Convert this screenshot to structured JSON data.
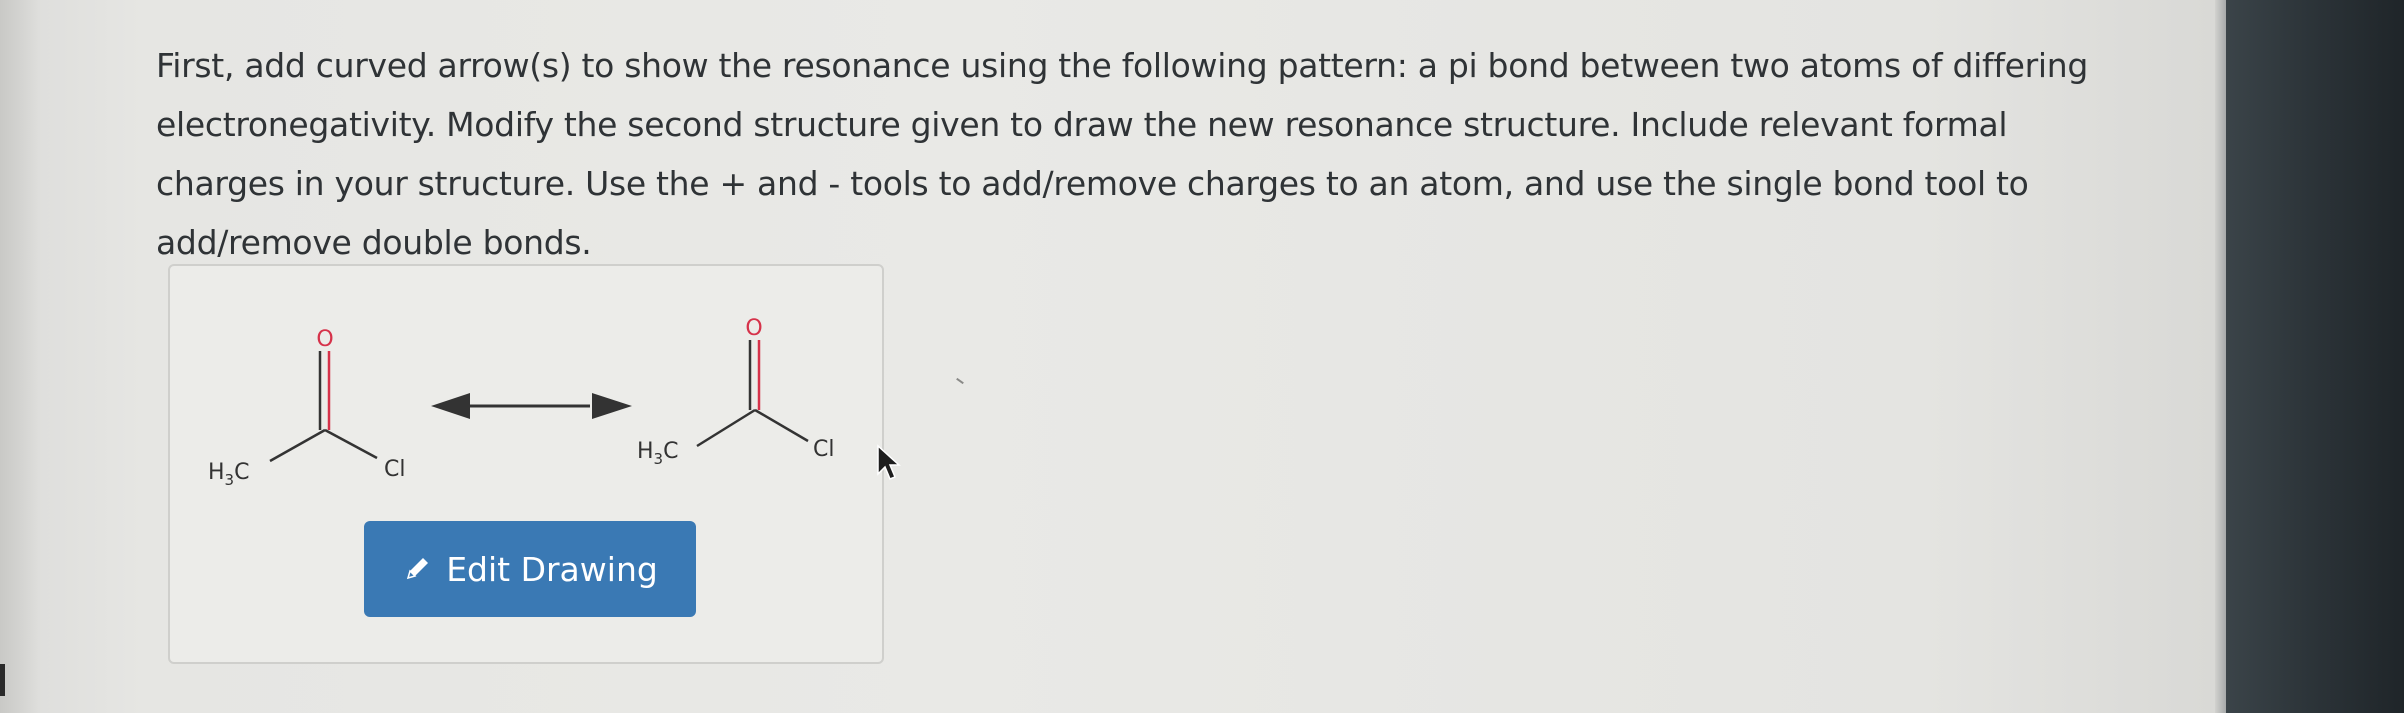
{
  "question": {
    "text": "First, add curved arrow(s) to show the resonance using the following pattern: a pi bond between two atoms of differing electronegativity. Modify the second structure given to draw the new resonance structure. Include relevant formal charges in your structure. Use the + and - tools to add/remove charges to an atom, and use the single bond tool to add/remove double bonds."
  },
  "structure_1": {
    "methyl_main": "H",
    "methyl_sub": "3",
    "methyl_tail": "C",
    "oxygen": "O",
    "chlorine": "Cl"
  },
  "structure_2": {
    "methyl_main": "H",
    "methyl_sub": "3",
    "methyl_tail": "C",
    "oxygen": "O",
    "chlorine": "Cl"
  },
  "edit_button": {
    "label": "Edit Drawing",
    "icon": "pencil-icon"
  },
  "colors": {
    "button_bg": "#3a79b4",
    "oxygen": "#d6324a",
    "bond": "#333333"
  }
}
